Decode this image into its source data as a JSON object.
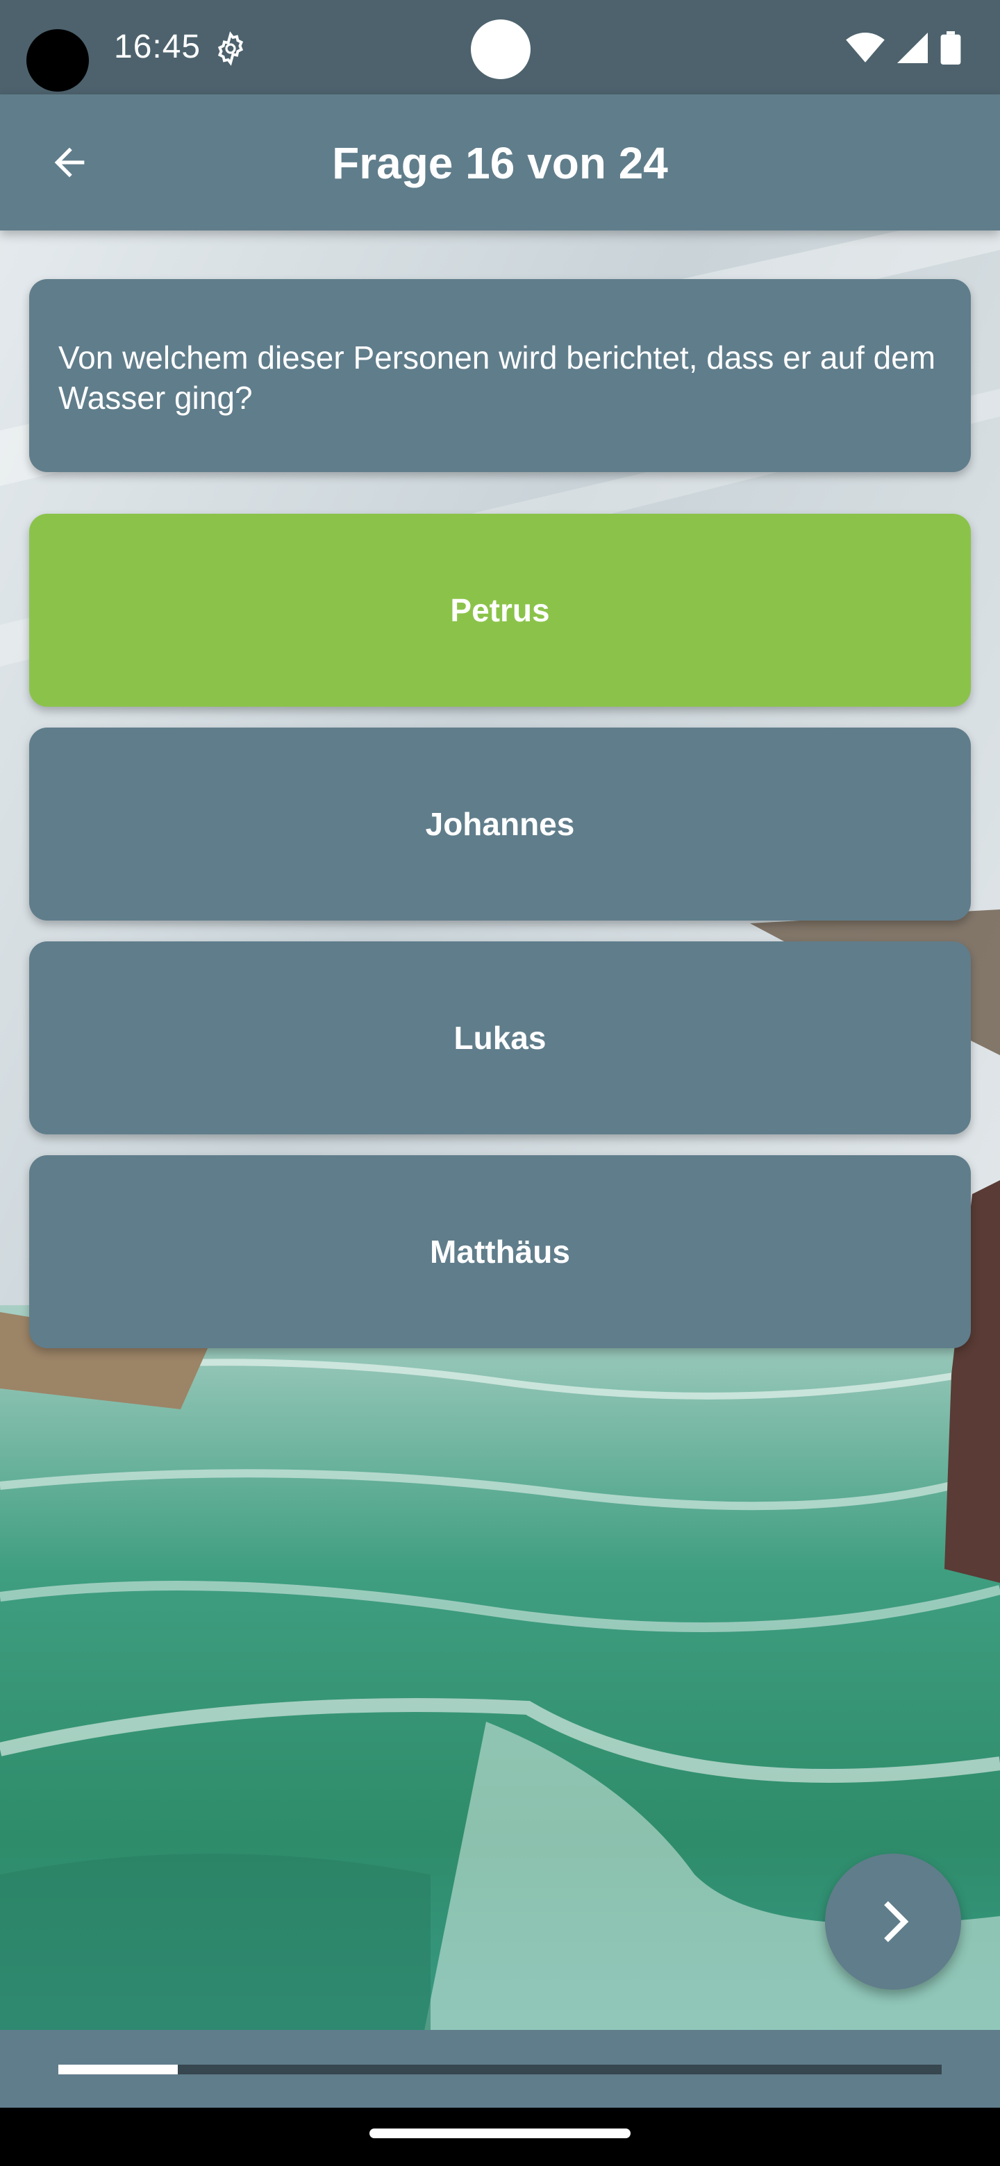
{
  "status_bar": {
    "time": "16:45",
    "icons": [
      "settings-icon",
      "wifi-icon",
      "signal-icon",
      "battery-icon"
    ]
  },
  "app_bar": {
    "title": "Frage 16 von 24",
    "back_icon": "arrow-back-icon"
  },
  "question": {
    "text": "Von welchem dieser Personen wird berichtet, dass er auf dem Wasser ging?"
  },
  "answers": [
    {
      "label": "Petrus",
      "state": "correct"
    },
    {
      "label": "Johannes",
      "state": "neutral"
    },
    {
      "label": "Lukas",
      "state": "neutral"
    },
    {
      "label": "Matthäus",
      "state": "neutral"
    }
  ],
  "fab": {
    "icon": "chevron-right-icon"
  },
  "progress": {
    "value": 0.135
  },
  "colors": {
    "primary": "#607d8b",
    "status_bar": "#4d626d",
    "correct": "#8bc34a",
    "progress_track": "#37474f"
  }
}
